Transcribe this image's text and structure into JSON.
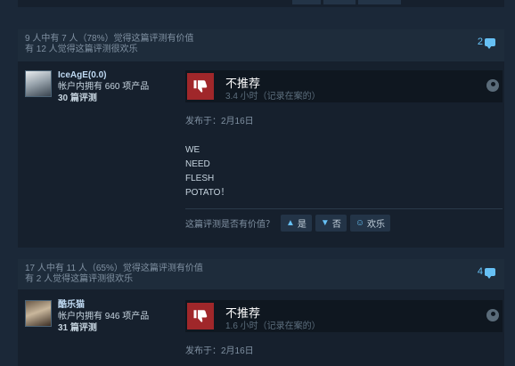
{
  "reviews": [
    {
      "helpful_line1": "9 人中有 7 人（78%）觉得这篇评测有价值",
      "helpful_line2": "有 12 人觉得这篇评测很欢乐",
      "comment_count": "2",
      "author": {
        "name": "IceAgE(0.0)",
        "products": "帐户内拥有 660 项产品",
        "reviews": "30 篇评测"
      },
      "verdict": "不推荐",
      "hours": "3.4 小时（记录在案的）",
      "posted": "发布于：2月16日",
      "body": [
        "WE",
        "NEED",
        "FLESH",
        "POTATO！"
      ],
      "vote_question": "这篇评测是否有价值？",
      "vote_yes": "是",
      "vote_no": "否",
      "vote_funny": "欢乐"
    },
    {
      "helpful_line1": "17 人中有 11 人（65%）觉得这篇评测有价值",
      "helpful_line2": "有 2 人觉得这篇评测很欢乐",
      "comment_count": "4",
      "author": {
        "name": "酷乐猫",
        "products": "帐户内拥有 946 项产品",
        "reviews": "31 篇评测"
      },
      "verdict": "不推荐",
      "hours": "1.6 小时（记录在案的）",
      "posted": "发布于：2月16日"
    }
  ],
  "icons": {
    "thumbs_down": "thumbs-down-icon",
    "comment": "comment-bubble-icon",
    "steam": "steam-icon",
    "thumbs_up": "thumbs-up-icon",
    "smile": "smile-icon"
  },
  "colors": {
    "background": "#1b2838",
    "card": "#16202d",
    "not_recommended": "#a0272a",
    "link": "#66c0f4"
  }
}
